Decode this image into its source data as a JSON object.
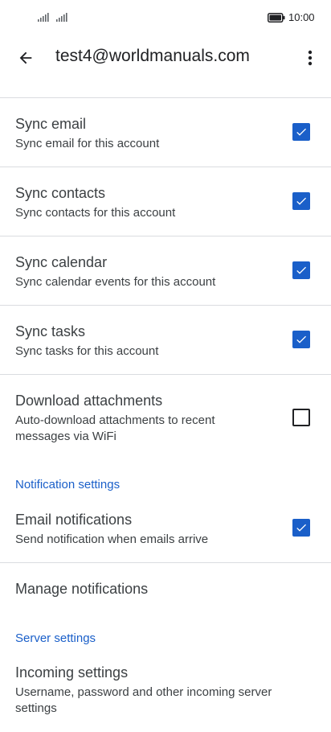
{
  "status_bar": {
    "time": "10:00"
  },
  "app_bar": {
    "title": "test4@worldmanuals.com"
  },
  "settings": {
    "sync_email": {
      "title": "Sync email",
      "subtitle": "Sync email for this account",
      "checked": true
    },
    "sync_contacts": {
      "title": "Sync contacts",
      "subtitle": "Sync contacts for this account",
      "checked": true
    },
    "sync_calendar": {
      "title": "Sync calendar",
      "subtitle": "Sync calendar events for this account",
      "checked": true
    },
    "sync_tasks": {
      "title": "Sync tasks",
      "subtitle": "Sync tasks for this account",
      "checked": true
    },
    "download_attachments": {
      "title": "Download attachments",
      "subtitle": "Auto-download attachments to recent messages via WiFi",
      "checked": false
    }
  },
  "notification_section": {
    "header": "Notification settings",
    "email_notifications": {
      "title": "Email notifications",
      "subtitle": "Send notification when emails arrive",
      "checked": true
    },
    "manage_notifications": {
      "title": "Manage notifications"
    }
  },
  "server_section": {
    "header": "Server settings",
    "incoming_settings": {
      "title": "Incoming settings",
      "subtitle": "Username, password and other incoming server settings"
    }
  },
  "colors": {
    "accent": "#1a5fc9",
    "divider": "#dadce0",
    "text": "#3c4043"
  }
}
